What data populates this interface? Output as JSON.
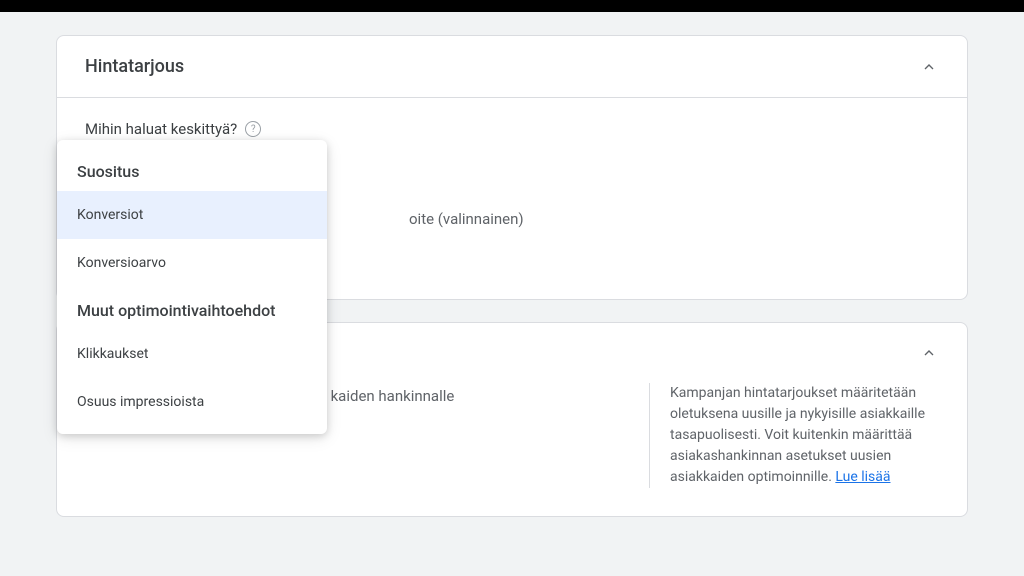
{
  "bidding": {
    "title": "Hintatarjous",
    "question": "Mihin haluat keskittyä?",
    "optionalText": "oite (valinnainen)",
    "dropdown": {
      "headerRecommend": "Suositus",
      "itemConversions": "Konversiot",
      "itemConversionValue": "Konversioarvo",
      "headerOther": "Muut optimointivaihtoehdot",
      "itemClicks": "Klikkaukset",
      "itemImpressionShare": "Osuus impressioista"
    }
  },
  "acquisition": {
    "leftText": "kaiden hankinnalle",
    "rightText": "Kampanjan hintatarjoukset määritetään oletuksena uusille ja nykyisille asiakkaille tasapuolisesti. Voit kuitenkin määrittää asiakashankinnan asetukset uusien asiakkaiden optimoinnille. ",
    "linkText": "Lue lisää"
  }
}
